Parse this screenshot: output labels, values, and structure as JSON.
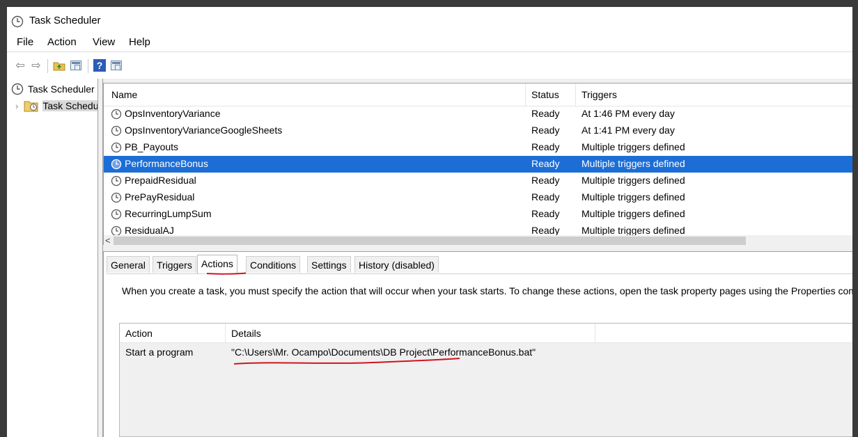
{
  "window": {
    "title": "Task Scheduler"
  },
  "menu": [
    "File",
    "Action",
    "View",
    "Help"
  ],
  "toolbar": {
    "icons": [
      "back-arrow-icon",
      "forward-arrow-icon",
      "folder-up-icon",
      "show-hide-console-tree-icon",
      "help-icon",
      "show-action-pane-icon"
    ]
  },
  "tree": {
    "root_label": "Task Scheduler (Local)",
    "child_label": "Task Scheduler Library"
  },
  "task_list": {
    "columns": {
      "name": "Name",
      "status": "Status",
      "triggers": "Triggers"
    },
    "rows": [
      {
        "name": "OpsInventoryVariance",
        "status": "Ready",
        "triggers": "At 1:46 PM every day"
      },
      {
        "name": "OpsInventoryVarianceGoogleSheets",
        "status": "Ready",
        "triggers": "At 1:41 PM every day"
      },
      {
        "name": "PB_Payouts",
        "status": "Ready",
        "triggers": "Multiple triggers defined"
      },
      {
        "name": "PerformanceBonus",
        "status": "Ready",
        "triggers": "Multiple triggers defined",
        "selected": true
      },
      {
        "name": "PrepaidResidual",
        "status": "Ready",
        "triggers": "Multiple triggers defined"
      },
      {
        "name": "PrePayResidual",
        "status": "Ready",
        "triggers": "Multiple triggers defined"
      },
      {
        "name": "RecurringLumpSum",
        "status": "Ready",
        "triggers": "Multiple triggers defined"
      },
      {
        "name": "ResidualAJ",
        "status": "Ready",
        "triggers": "Multiple triggers defined"
      }
    ],
    "scroll_left_glyph": "<"
  },
  "detail": {
    "tabs": [
      "General",
      "Triggers",
      "Actions",
      "Conditions",
      "Settings",
      "History (disabled)"
    ],
    "active_tab": "Actions",
    "description": "When you create a task, you must specify the action that will occur when your task starts.  To change these actions, open the task property pages using the Properties command.",
    "actions_table": {
      "columns": {
        "action": "Action",
        "details": "Details"
      },
      "rows": [
        {
          "action": "Start a program",
          "details": "\"C:\\Users\\Mr. Ocampo\\Documents\\DB Project\\PerformanceBonus.bat\""
        }
      ]
    }
  },
  "colors": {
    "selection": "#1c6ed6",
    "annotation": "#d0141c",
    "background_frame": "#3a3a3a"
  }
}
